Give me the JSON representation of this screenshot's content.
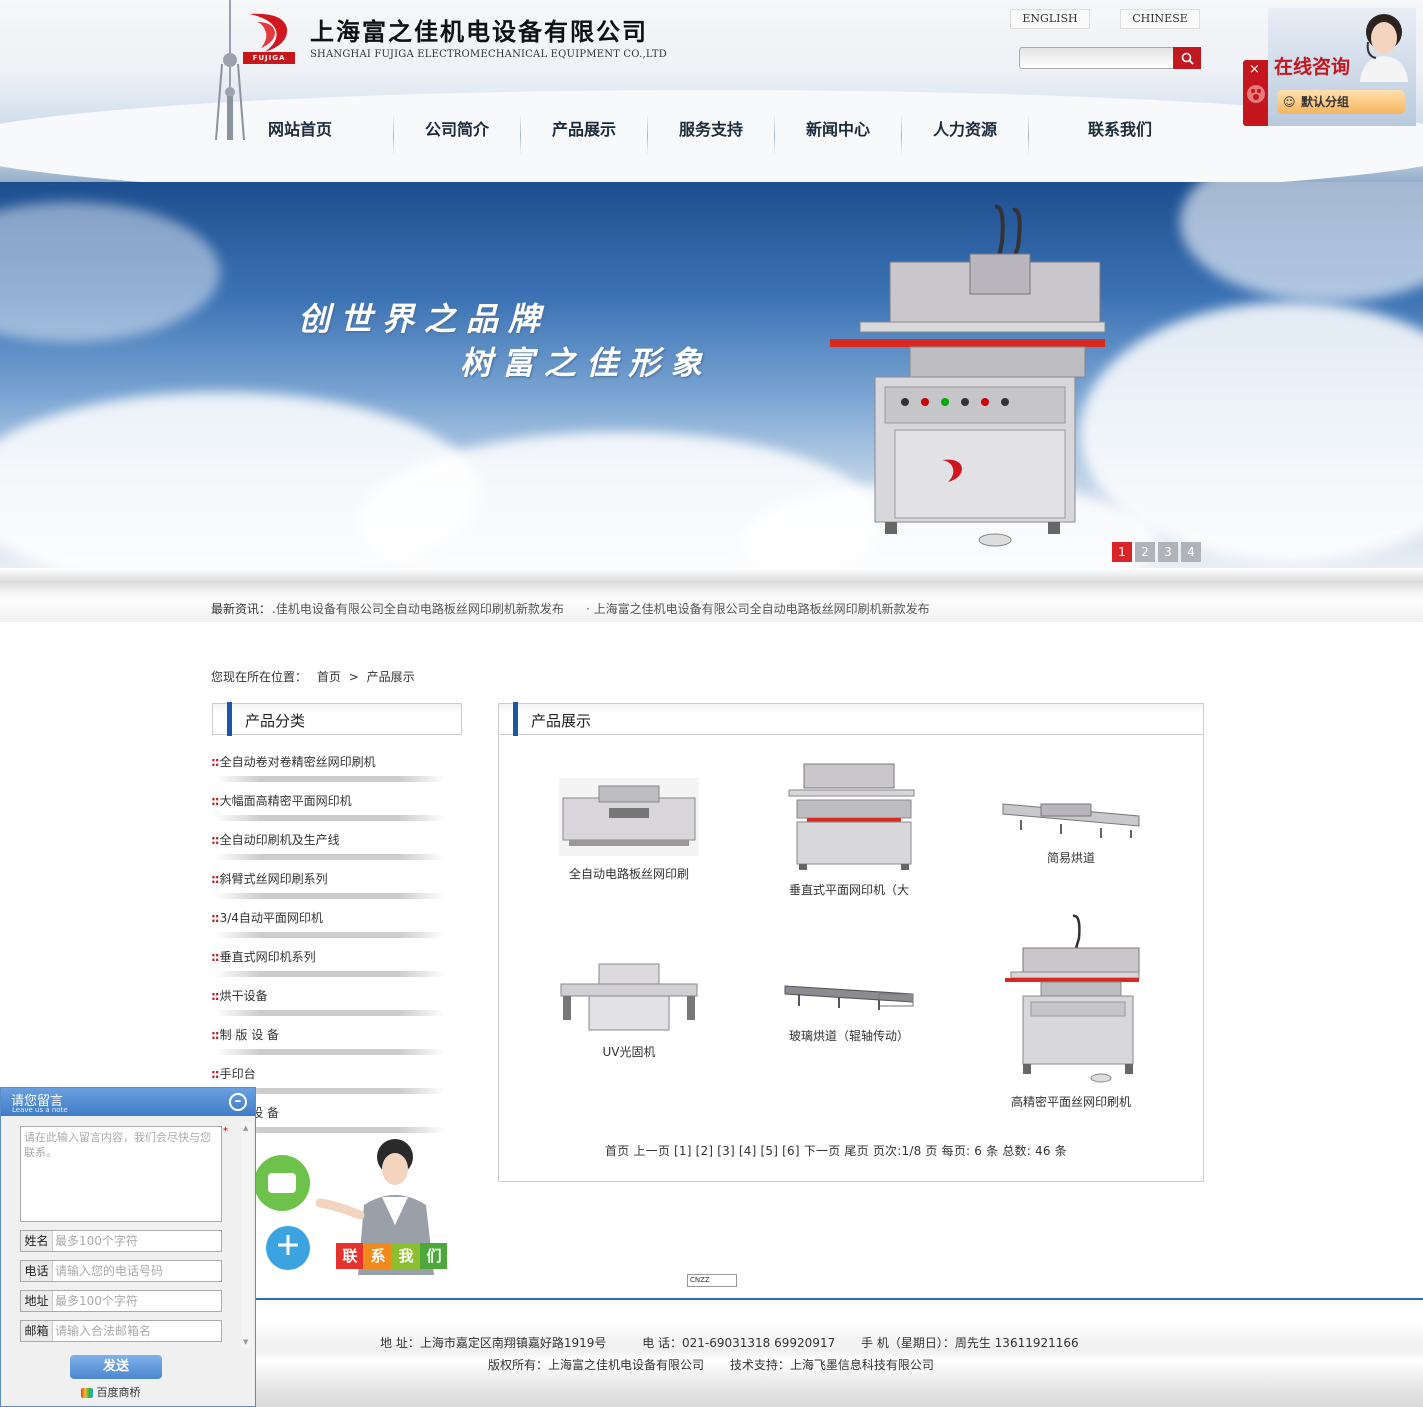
{
  "header": {
    "company_cn": "上海富之佳机电设备有限公司",
    "company_en": "SHANGHAI FUJIGA ELECTROMECHANICAL EQUIPMENT CO.,LTD",
    "logo_text": "FUJIGA",
    "lang_english": "ENGLISH",
    "lang_chinese": "CHINESE",
    "search_placeholder": "",
    "search_icon": "magnifier-icon"
  },
  "nav": [
    {
      "label": "网站首页"
    },
    {
      "label": "公司简介"
    },
    {
      "label": "产品展示"
    },
    {
      "label": "服务支持"
    },
    {
      "label": "新闻中心"
    },
    {
      "label": "人力资源"
    },
    {
      "label": "联系我们"
    }
  ],
  "banner": {
    "slogan_line1": "创世界之品牌",
    "slogan_line2": "树富之佳形象",
    "slides": [
      "1",
      "2",
      "3",
      "4"
    ],
    "active_slide": "1"
  },
  "news": {
    "label": "最新资讯：",
    "item1": ".佳机电设备有限公司全自动电路板丝网印刷机新款发布",
    "item2": "· 上海富之佳机电设备有限公司全自动电路板丝网印刷机新款发布"
  },
  "breadcrumb": {
    "prefix": "您现在所在位置：",
    "home": "首页",
    "sep": ">",
    "current": "产品展示"
  },
  "sidebar": {
    "title": "产品分类",
    "marker": "::",
    "items": [
      {
        "label": "全自动卷对卷精密丝网印刷机"
      },
      {
        "label": "大幅面高精密平面网印机"
      },
      {
        "label": "全自动印刷机及生产线"
      },
      {
        "label": "斜臂式丝网印刷系列"
      },
      {
        "label": "3/4自动平面网印机"
      },
      {
        "label": "垂直式网印机系列"
      },
      {
        "label": "烘干设备"
      },
      {
        "label": "制 版 设 备"
      },
      {
        "label": "手印台"
      },
      {
        "label": "辅 助 设 备"
      }
    ],
    "contact_banner": [
      "联",
      "系",
      "我",
      "们"
    ]
  },
  "products": {
    "title": "产品展示",
    "items": [
      {
        "name": "全自动电路板丝网印刷"
      },
      {
        "name": "垂直式平面网印机（大"
      },
      {
        "name": "简易烘道"
      },
      {
        "name": "UV光固机"
      },
      {
        "name": "玻璃烘道（辊轴传动）"
      },
      {
        "name": "高精密平面丝网印刷机"
      }
    ],
    "pager": {
      "first": "首页",
      "prev": "上一页",
      "pages": [
        "[1]",
        "[2]",
        "[3]",
        "[4]",
        "[5]",
        "[6]"
      ],
      "next": "下一页",
      "last": "尾页",
      "info": "页次:1/8 页 每页: 6 条 总数: 46 条"
    }
  },
  "cnzz": "CNZZ",
  "footer": {
    "address": "地 址：上海市嘉定区南翔镇嘉好路1919号",
    "phone": "电 话：021-69031318 69920917",
    "mobile": "手 机（星期日）：周先生 13611921166",
    "copyright": "版权所有：上海富之佳机电设备有限公司",
    "support": "技术支持：上海飞墨信息科技有限公司"
  },
  "consult": {
    "title": "在线咨询",
    "group": "默认分组"
  },
  "message_box": {
    "title": "请您留言",
    "subtitle": "Leave us a note",
    "placeholder": "请在此输入留言内容，我们会尽快与您联系。",
    "fields": [
      {
        "label": "姓名",
        "placeholder": "最多100个字符"
      },
      {
        "label": "电话",
        "placeholder": "请输入您的电话号码"
      },
      {
        "label": "地址",
        "placeholder": "最多100个字符"
      },
      {
        "label": "邮箱",
        "placeholder": "请输入合法邮箱名"
      }
    ],
    "send": "发送",
    "brand": "百度商桥"
  },
  "colors": {
    "brand_red": "#c4161c",
    "nav_blue": "#1b57a5",
    "footer_line": "#2a72bb"
  }
}
